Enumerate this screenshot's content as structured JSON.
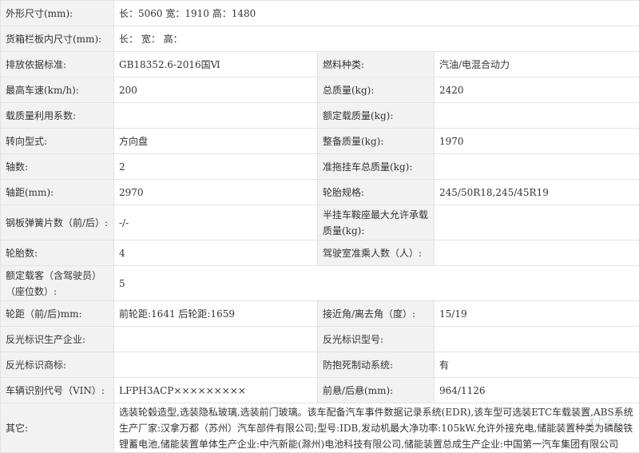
{
  "rows": [
    {
      "l1": "外形尺寸(mm):",
      "v1": "长：5060 宽：1910 高：1480"
    },
    {
      "l1": "货箱栏板内尺寸(mm):",
      "v1": "长：  宽：  高："
    },
    {
      "l1": "排放依据标准:",
      "v1": "GB18352.6-2016国Ⅵ",
      "l2": "燃料种类:",
      "v2": "汽油/电混合动力"
    },
    {
      "l1": "最高车速(km/h):",
      "v1": "200",
      "l2": "总质量(kg):",
      "v2": "2420"
    },
    {
      "l1": "载质量利用系数:",
      "v1": "",
      "l2": "额定载质量(kg):",
      "v2": ""
    },
    {
      "l1": "转向型式:",
      "v1": "方向盘",
      "l2": "整备质量(kg):",
      "v2": "1970"
    },
    {
      "l1": "轴数:",
      "v1": "2",
      "l2": "准拖挂车总质量(kg):",
      "v2": ""
    },
    {
      "l1": "轴距(mm):",
      "v1": "2970",
      "l2": "轮胎规格:",
      "v2": "245/50R18,245/45R19"
    },
    {
      "l1": "钢板弹簧片数（前/后）:",
      "v1": "-/-",
      "l2": "半挂车鞍座最大允许承载质量(kg):",
      "v2": ""
    },
    {
      "l1": "轮胎数:",
      "v1": "4",
      "l2": "驾驶室准乘人数（人）:",
      "v2": ""
    },
    {
      "l1": "额定载客（含驾驶员）（座位数）:",
      "v1": "5"
    },
    {
      "l1": "轮距（前/后)mm:",
      "v1": "前轮距:1641 后轮距:1659",
      "l2": "接近角/离去角（度）:",
      "v2": "15/19"
    },
    {
      "l1": "反光标识生产企业:",
      "v1": "",
      "l2": "反光标识型号:",
      "v2": ""
    },
    {
      "l1": "反光标识商标:",
      "v1": "",
      "l2": "防抱死制动系统:",
      "v2": "有"
    },
    {
      "l1": "车辆识别代号（VIN）:",
      "v1": "LFPH3ACP×××××××××",
      "l2": "前悬/后悬(mm):",
      "v2": "964/1126"
    },
    {
      "l1": "其它:",
      "v1": "选装轮毂造型,选装隐私玻璃,选装前门玻璃。该车配备汽车事件数据记录系统(EDR),该车型可选装ETC车载装置,ABS系统生产厂家:汉拿万都（苏州）汽车部件有限公司;型号:IDB,发动机最大净功率:105kW.允许外接充电,储能装置种类为磷酸铁锂蓄电池,储能装置单体生产企业:中汽新能(滁州)电池科技有限公司,储能装置总成生产企业:中国第一汽车集团有限公司"
    }
  ],
  "watermark": "PCAUTO"
}
